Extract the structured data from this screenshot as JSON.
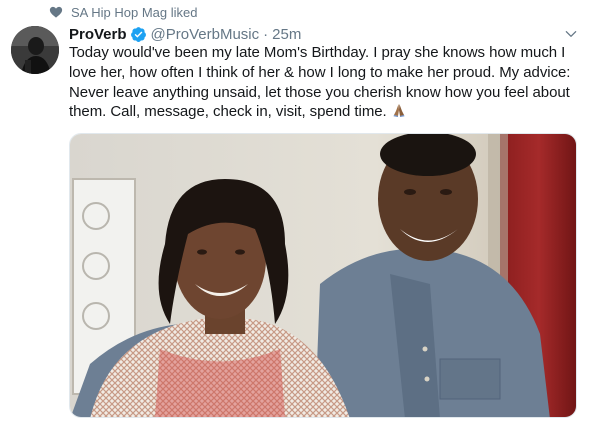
{
  "social_context": {
    "text": "SA Hip Hop Mag liked",
    "icon": "heart-icon"
  },
  "tweet": {
    "display_name": "ProVerb",
    "handle": "@ProVerbMusic",
    "separator": "·",
    "timestamp": "25m",
    "verified": true,
    "text": "Today would've been my late Mom's Birthday. I pray she knows how much I love her, how often I think of her & how I long to make her proud. My advice: Never leave anything unsaid, let those you cherish know how you feel about them. Call, message, check in, visit, spend time.",
    "emoji": "pray-emoji",
    "photo": "photo of a smiling woman and a smiling man in a grey denim shirt"
  },
  "colors": {
    "text_primary": "#14171a",
    "text_secondary": "#657786",
    "verified_blue": "#1da1f2",
    "border": "#e1e8ed"
  }
}
